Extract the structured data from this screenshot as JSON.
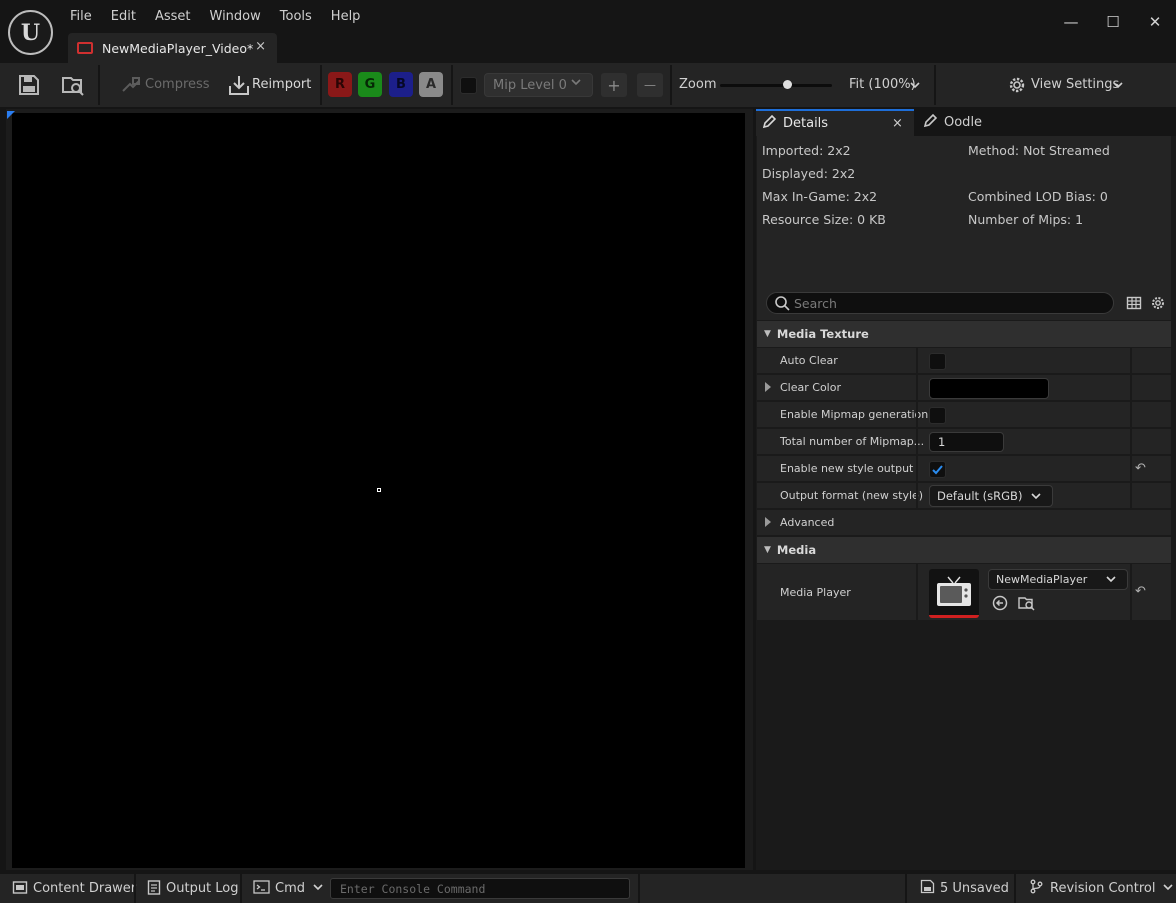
{
  "menu": [
    "File",
    "Edit",
    "Asset",
    "Window",
    "Tools",
    "Help"
  ],
  "tab": {
    "title": "NewMediaPlayer_Video*",
    "close": "×"
  },
  "window": {
    "minimize": "—",
    "maximize": "☐",
    "close": "✕"
  },
  "toolbar": {
    "compress_label": "Compress",
    "reimport_label": "Reimport",
    "channels": [
      "R",
      "G",
      "B",
      "A"
    ],
    "channel_colors": [
      "#8a1818",
      "#1a8a1a",
      "#1c1f8a",
      "#8a8a8a"
    ],
    "mip_label": "Mip Level 0",
    "plus": "+",
    "minus": "—",
    "zoom_label": "Zoom",
    "zoom_level": 0.6,
    "fit_label": "Fit (100%)",
    "view_settings_label": "View Settings"
  },
  "details": {
    "tab_details": "Details",
    "tab_close": "×",
    "tab_oodle": "Oodle",
    "info": {
      "imported": "Imported: 2x2",
      "method": "Method: Not Streamed",
      "displayed": "Displayed: 2x2",
      "max_ingame": "Max In-Game: 2x2",
      "combined_lod": "Combined LOD Bias: 0",
      "resource_size": "Resource Size: 0 KB",
      "num_mips": "Number of Mips: 1"
    },
    "search_placeholder": "Search",
    "media_texture": {
      "category": "Media Texture",
      "auto_clear": "Auto Clear",
      "clear_color": "Clear Color",
      "enable_mipmap": "Enable Mipmap generation",
      "total_mipmaps": "Total number of Mipmap...",
      "total_mipmaps_value": "1",
      "enable_new_style": "Enable new style output",
      "output_format": "Output format (new style)",
      "output_format_value": "Default (sRGB)",
      "advanced": "Advanced"
    },
    "media": {
      "category": "Media",
      "media_player": "Media Player",
      "media_player_value": "NewMediaPlayer"
    }
  },
  "status": {
    "content_drawer": "Content Drawer",
    "output_log": "Output Log",
    "cmd": "Cmd",
    "console_placeholder": "Enter Console Command",
    "unsaved": "5 Unsaved",
    "revision_control": "Revision Control"
  }
}
